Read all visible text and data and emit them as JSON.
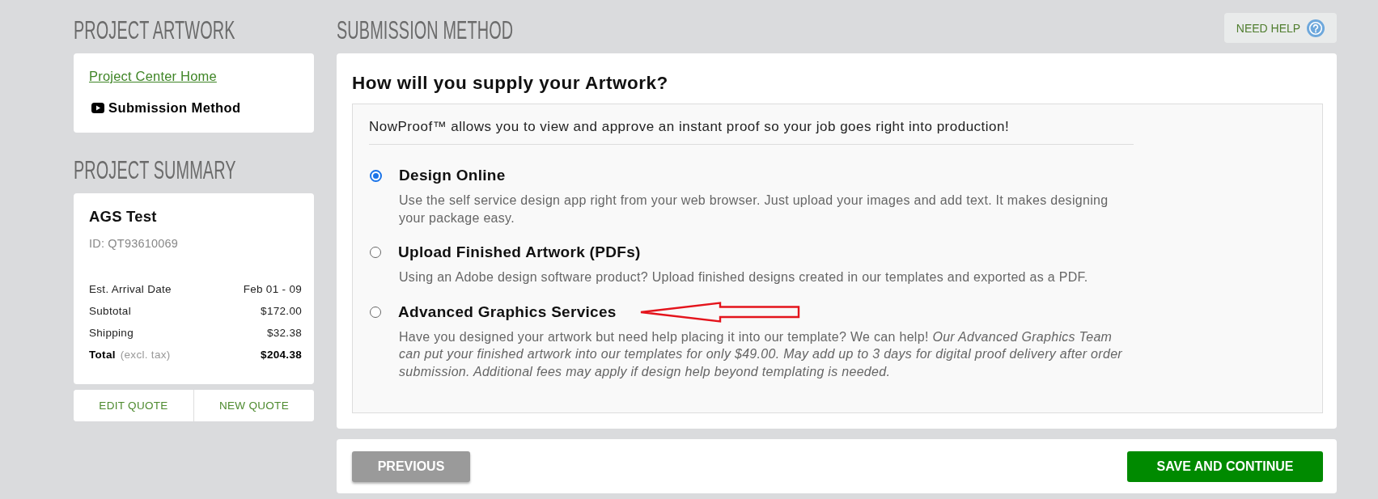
{
  "sidebar": {
    "artwork": {
      "heading": "PROJECT ARTWORK",
      "items": [
        {
          "label": "Project Center Home",
          "selected": false
        },
        {
          "label": "Submission Method",
          "selected": true
        }
      ]
    },
    "summary": {
      "heading": "PROJECT SUMMARY",
      "project_name": "AGS Test",
      "project_id": "ID: QT93610069",
      "rows": [
        {
          "kind": "item",
          "label": "Est. Arrival Date",
          "value": "Feb 01 - 09"
        },
        {
          "kind": "item",
          "label": "Subtotal",
          "value": "$172.00"
        },
        {
          "kind": "item",
          "label": "Shipping",
          "value": "$32.38"
        },
        {
          "kind": "total",
          "label": "Total",
          "note": "(excl. tax)",
          "value": "$204.38"
        }
      ],
      "buttons": [
        "EDIT QUOTE",
        "NEW QUOTE"
      ]
    }
  },
  "main": {
    "heading": "SUBMISSION METHOD",
    "help_button": "NEED HELP",
    "card": {
      "title": "How will you supply your Artwork?",
      "intro": "NowProof™ allows you to view and approve an instant proof so your job goes right into production!",
      "options": [
        {
          "label": "Design Online",
          "description": "Use the self service design app right from your web browser. Just upload your images and add text. It makes designing your package easy.",
          "selected": true,
          "pointer_arrow": false
        },
        {
          "label": "Upload Finished Artwork (PDFs)",
          "description": "Using an Adobe design software product? Upload finished designs created in our templates and exported as a PDF.",
          "selected": false,
          "pointer_arrow": false
        },
        {
          "label": "Advanced Graphics Services",
          "description": "Have you designed your artwork but need help placing it into our template? We can help! *Our Advanced Graphics Team can put your finished artwork into our templates for only $49.00. May add up to 3 days for digital proof delivery after order submission. Additional fees may apply if design help beyond templating is needed.*",
          "selected": false,
          "pointer_arrow": true
        }
      ]
    },
    "footer_buttons": [
      {
        "label": "PREVIOUS",
        "kind": "secondary"
      },
      {
        "label": "SAVE AND CONTINUE",
        "kind": "primary"
      }
    ]
  }
}
